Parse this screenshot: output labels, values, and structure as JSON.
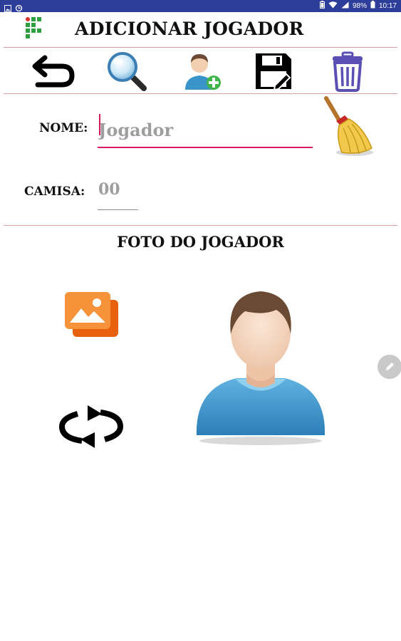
{
  "status_bar": {
    "battery": "98%",
    "time": "10:17",
    "left_icons": [
      "image-notification-icon",
      "sync-notification-icon"
    ],
    "right_icons": [
      "battery-saver-icon",
      "wifi-icon",
      "signal-icon"
    ],
    "background": "#2c3e9a"
  },
  "header": {
    "title": "ADICIONAR JOGADOR",
    "logo_icon": "institute-logo-icon"
  },
  "toolbar": {
    "buttons": [
      {
        "name": "back-button",
        "icon": "undo-arrow-icon"
      },
      {
        "name": "search-button",
        "icon": "magnifier-icon"
      },
      {
        "name": "add-player-button",
        "icon": "add-user-icon"
      },
      {
        "name": "save-button",
        "icon": "floppy-disk-icon"
      },
      {
        "name": "delete-button",
        "icon": "trash-icon"
      }
    ]
  },
  "form": {
    "name_label": "NOME:",
    "name_placeholder": "Jogador",
    "name_value": "",
    "clear_icon": "broom-icon",
    "shirt_label": "CAMISA:",
    "shirt_placeholder": "00",
    "shirt_value": ""
  },
  "photo": {
    "title": "FOTO DO JOGADOR",
    "gallery_icon": "gallery-icon",
    "rotate_icon": "rotate-icon",
    "avatar_icon": "player-avatar",
    "edit_icon": "pencil-icon"
  },
  "colors": {
    "accent": "#d81b60",
    "divider": "#d9a1a6",
    "gallery": "#f07c1c",
    "trash": "#5b4fb3",
    "avatar_shirt": "#3a94c9"
  }
}
